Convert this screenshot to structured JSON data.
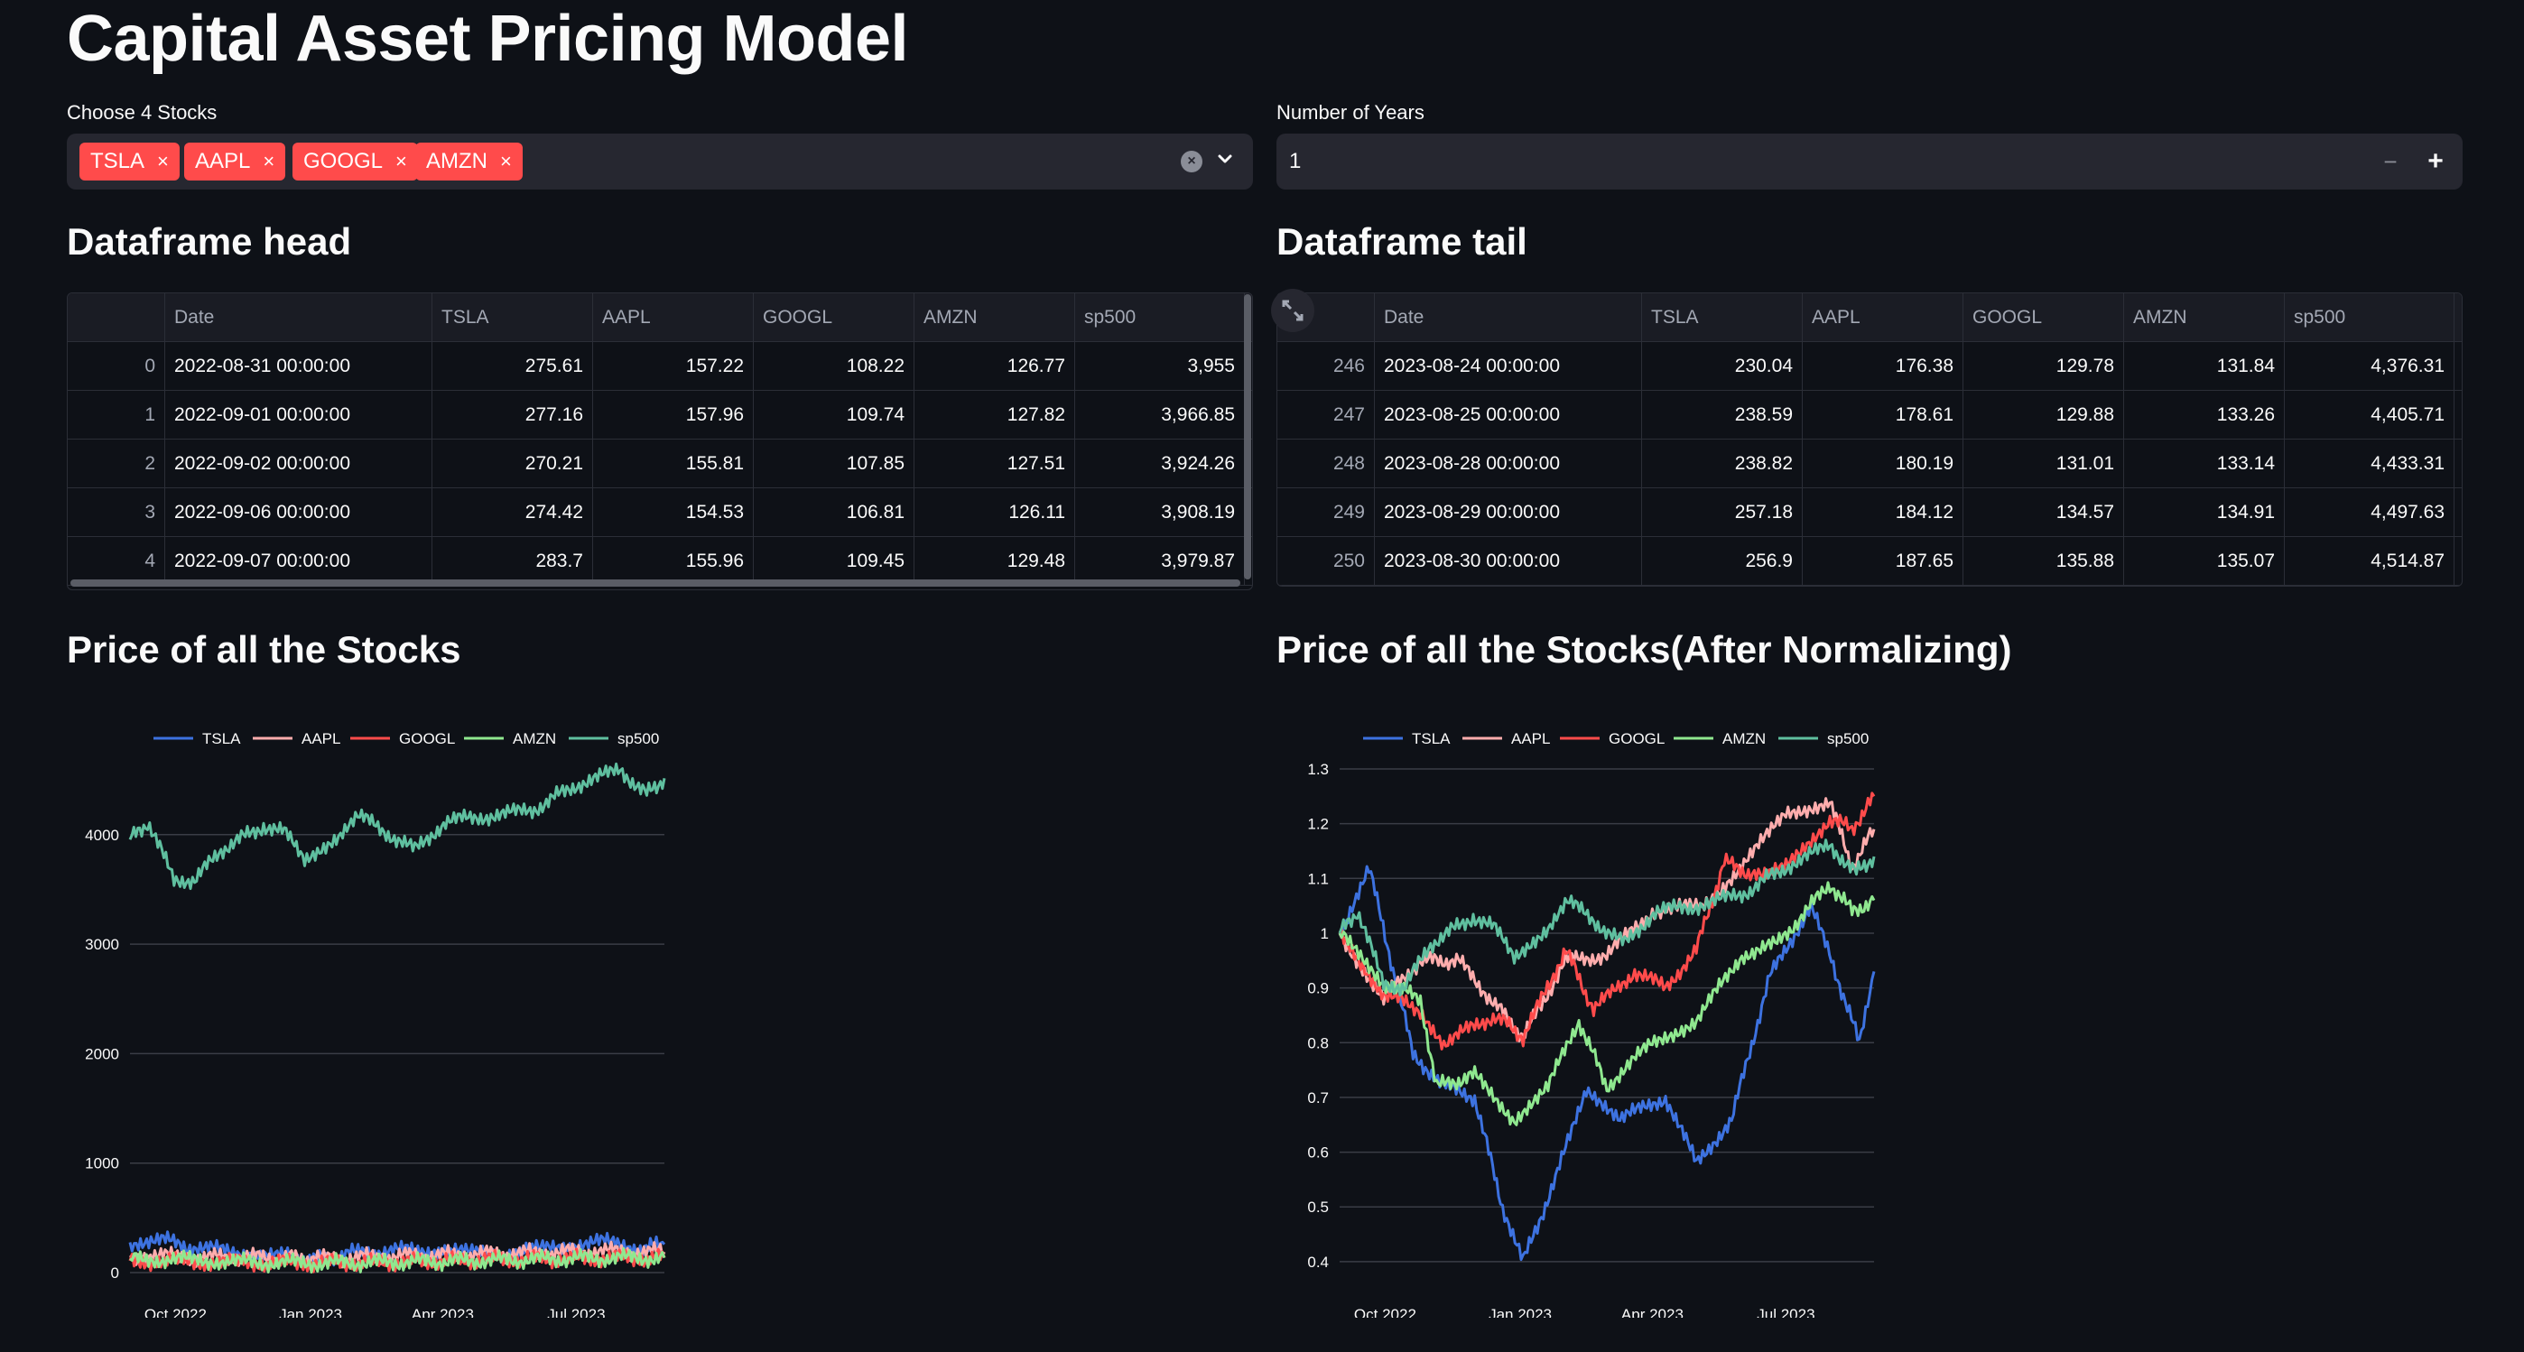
{
  "header": {
    "title": "Capital Asset Pricing Model"
  },
  "stock_select": {
    "label": "Choose 4 Stocks",
    "chips": [
      "TSLA",
      "AAPL",
      "GOOGL",
      "AMZN"
    ],
    "chip_remove": "×",
    "clear_glyph": "×",
    "icons": {
      "clear": "clear-icon",
      "dropdown": "chevron-down-icon"
    }
  },
  "years_input": {
    "label": "Number of Years",
    "value": "1",
    "minus": "−",
    "plus": "+"
  },
  "head_table": {
    "title": "Dataframe head",
    "columns": [
      "",
      "Date",
      "TSLA",
      "AAPL",
      "GOOGL",
      "AMZN",
      "sp500"
    ],
    "rows": [
      [
        "0",
        "2022-08-31 00:00:00",
        "275.61",
        "157.22",
        "108.22",
        "126.77",
        "3,955"
      ],
      [
        "1",
        "2022-09-01 00:00:00",
        "277.16",
        "157.96",
        "109.74",
        "127.82",
        "3,966.85"
      ],
      [
        "2",
        "2022-09-02 00:00:00",
        "270.21",
        "155.81",
        "107.85",
        "127.51",
        "3,924.26"
      ],
      [
        "3",
        "2022-09-06 00:00:00",
        "274.42",
        "154.53",
        "106.81",
        "126.11",
        "3,908.19"
      ],
      [
        "4",
        "2022-09-07 00:00:00",
        "283.7",
        "155.96",
        "109.45",
        "129.48",
        "3,979.87"
      ]
    ]
  },
  "tail_table": {
    "title": "Dataframe tail",
    "columns": [
      "",
      "Date",
      "TSLA",
      "AAPL",
      "GOOGL",
      "AMZN",
      "sp500"
    ],
    "rows": [
      [
        "246",
        "2023-08-24 00:00:00",
        "230.04",
        "176.38",
        "129.78",
        "131.84",
        "4,376.31"
      ],
      [
        "247",
        "2023-08-25 00:00:00",
        "238.59",
        "178.61",
        "129.88",
        "133.26",
        "4,405.71"
      ],
      [
        "248",
        "2023-08-28 00:00:00",
        "238.82",
        "180.19",
        "131.01",
        "133.14",
        "4,433.31"
      ],
      [
        "249",
        "2023-08-29 00:00:00",
        "257.18",
        "184.12",
        "134.57",
        "134.91",
        "4,497.63"
      ],
      [
        "250",
        "2023-08-30 00:00:00",
        "256.9",
        "187.65",
        "135.88",
        "135.07",
        "4,514.87"
      ]
    ]
  },
  "chart_titles": {
    "price": "Price of all the Stocks",
    "normalized": "Price of all the Stocks(After Normalizing)"
  },
  "colors": {
    "TSLA": "#3d72e0",
    "AAPL": "#ffadad",
    "GOOGL": "#ff4b4b",
    "AMZN": "#8fe88f",
    "sp500": "#5fbf9f",
    "grid": "#3a3d46",
    "text": "#fafafa"
  },
  "chart_data": [
    {
      "type": "line",
      "title": "",
      "x_ticks": [
        "Oct 2022",
        "Jan 2023",
        "Apr 2023",
        "Jul 2023"
      ],
      "x_range": [
        "2022-08-31",
        "2023-08-30"
      ],
      "ylim": [
        0,
        4600
      ],
      "y_ticks": [
        0,
        1000,
        2000,
        3000,
        4000
      ],
      "legend_position": "top",
      "grid": true,
      "series": [
        {
          "name": "TSLA",
          "points": [
            [
              "2022-08-31",
              276
            ],
            [
              "2022-09-20",
              305
            ],
            [
              "2022-10-15",
              225
            ],
            [
              "2022-11-15",
              185
            ],
            [
              "2022-12-15",
              150
            ],
            [
              "2023-01-03",
              110
            ],
            [
              "2023-02-01",
              185
            ],
            [
              "2023-03-01",
              200
            ],
            [
              "2023-04-01",
              205
            ],
            [
              "2023-05-01",
              160
            ],
            [
              "2023-06-01",
              205
            ],
            [
              "2023-07-15",
              285
            ],
            [
              "2023-08-15",
              225
            ],
            [
              "2023-08-30",
              257
            ]
          ]
        },
        {
          "name": "AAPL",
          "points": [
            [
              "2022-08-31",
              157
            ],
            [
              "2022-10-15",
              140
            ],
            [
              "2022-12-15",
              140
            ],
            [
              "2023-01-03",
              125
            ],
            [
              "2023-03-01",
              150
            ],
            [
              "2023-05-01",
              170
            ],
            [
              "2023-07-15",
              195
            ],
            [
              "2023-08-30",
              188
            ]
          ]
        },
        {
          "name": "GOOGL",
          "points": [
            [
              "2022-08-31",
              108
            ],
            [
              "2022-10-15",
              100
            ],
            [
              "2022-11-15",
              90
            ],
            [
              "2023-01-03",
              88
            ],
            [
              "2023-03-01",
              95
            ],
            [
              "2023-05-01",
              120
            ],
            [
              "2023-07-15",
              130
            ],
            [
              "2023-08-30",
              136
            ]
          ]
        },
        {
          "name": "AMZN",
          "points": [
            [
              "2022-08-31",
              127
            ],
            [
              "2022-10-15",
              115
            ],
            [
              "2022-11-15",
              95
            ],
            [
              "2023-01-03",
              85
            ],
            [
              "2023-03-01",
              95
            ],
            [
              "2023-05-01",
              110
            ],
            [
              "2023-07-15",
              133
            ],
            [
              "2023-08-30",
              135
            ]
          ]
        },
        {
          "name": "sp500",
          "points": [
            [
              "2022-08-31",
              3955
            ],
            [
              "2022-09-12",
              4110
            ],
            [
              "2022-09-30",
              3600
            ],
            [
              "2022-10-14",
              3580
            ],
            [
              "2022-11-01",
              3860
            ],
            [
              "2022-11-30",
              4080
            ],
            [
              "2022-12-14",
              4020
            ],
            [
              "2022-12-28",
              3790
            ],
            [
              "2023-01-20",
              3990
            ],
            [
              "2023-02-02",
              4180
            ],
            [
              "2023-03-13",
              3860
            ],
            [
              "2023-04-03",
              4120
            ],
            [
              "2023-05-01",
              4170
            ],
            [
              "2023-06-01",
              4220
            ],
            [
              "2023-06-30",
              4450
            ],
            [
              "2023-07-31",
              4590
            ],
            [
              "2023-08-18",
              4370
            ],
            [
              "2023-08-30",
              4515
            ]
          ]
        }
      ]
    },
    {
      "type": "line",
      "title": "",
      "x_ticks": [
        "Oct 2022",
        "Jan 2023",
        "Apr 2023",
        "Jul 2023"
      ],
      "x_range": [
        "2022-08-31",
        "2023-08-30"
      ],
      "ylim": [
        0.38,
        1.3
      ],
      "y_ticks": [
        0.4,
        0.5,
        0.6,
        0.7,
        0.8,
        0.9,
        1,
        1.1,
        1.2,
        1.3
      ],
      "legend_position": "top",
      "grid": true,
      "series": [
        {
          "name": "TSLA",
          "points": [
            [
              "2022-08-31",
              1.0
            ],
            [
              "2022-09-20",
              1.12
            ],
            [
              "2022-10-05",
              0.95
            ],
            [
              "2022-10-20",
              0.78
            ],
            [
              "2022-11-10",
              0.72
            ],
            [
              "2022-12-01",
              0.7
            ],
            [
              "2022-12-20",
              0.5
            ],
            [
              "2023-01-03",
              0.4
            ],
            [
              "2023-01-25",
              0.55
            ],
            [
              "2023-02-15",
              0.72
            ],
            [
              "2023-03-10",
              0.66
            ],
            [
              "2023-04-10",
              0.7
            ],
            [
              "2023-05-01",
              0.58
            ],
            [
              "2023-05-25",
              0.66
            ],
            [
              "2023-06-20",
              0.92
            ],
            [
              "2023-07-18",
              1.05
            ],
            [
              "2023-08-01",
              0.95
            ],
            [
              "2023-08-20",
              0.8
            ],
            [
              "2023-08-30",
              0.93
            ]
          ]
        },
        {
          "name": "AAPL",
          "points": [
            [
              "2022-08-31",
              1.0
            ],
            [
              "2022-09-30",
              0.88
            ],
            [
              "2022-10-25",
              0.95
            ],
            [
              "2022-11-20",
              0.95
            ],
            [
              "2022-12-15",
              0.87
            ],
            [
              "2023-01-03",
              0.81
            ],
            [
              "2023-02-01",
              0.95
            ],
            [
              "2023-03-01",
              0.96
            ],
            [
              "2023-04-01",
              1.04
            ],
            [
              "2023-05-05",
              1.05
            ],
            [
              "2023-06-01",
              1.12
            ],
            [
              "2023-07-01",
              1.22
            ],
            [
              "2023-07-31",
              1.24
            ],
            [
              "2023-08-15",
              1.12
            ],
            [
              "2023-08-30",
              1.19
            ]
          ]
        },
        {
          "name": "GOOGL",
          "points": [
            [
              "2022-08-31",
              1.0
            ],
            [
              "2022-09-30",
              0.89
            ],
            [
              "2022-10-25",
              0.86
            ],
            [
              "2022-11-10",
              0.8
            ],
            [
              "2022-12-15",
              0.85
            ],
            [
              "2023-01-03",
              0.81
            ],
            [
              "2023-02-01",
              0.97
            ],
            [
              "2023-02-20",
              0.86
            ],
            [
              "2023-03-20",
              0.93
            ],
            [
              "2023-04-10",
              0.9
            ],
            [
              "2023-05-01",
              0.97
            ],
            [
              "2023-05-20",
              1.13
            ],
            [
              "2023-06-15",
              1.1
            ],
            [
              "2023-07-01",
              1.12
            ],
            [
              "2023-07-31",
              1.21
            ],
            [
              "2023-08-15",
              1.19
            ],
            [
              "2023-08-30",
              1.25
            ]
          ]
        },
        {
          "name": "AMZN",
          "points": [
            [
              "2022-08-31",
              1.0
            ],
            [
              "2022-09-30",
              0.91
            ],
            [
              "2022-10-25",
              0.88
            ],
            [
              "2022-11-05",
              0.72
            ],
            [
              "2022-12-01",
              0.74
            ],
            [
              "2022-12-28",
              0.66
            ],
            [
              "2023-01-20",
              0.72
            ],
            [
              "2023-02-10",
              0.84
            ],
            [
              "2023-03-01",
              0.72
            ],
            [
              "2023-04-01",
              0.8
            ],
            [
              "2023-05-01",
              0.84
            ],
            [
              "2023-06-01",
              0.96
            ],
            [
              "2023-06-25",
              0.98
            ],
            [
              "2023-07-31",
              1.09
            ],
            [
              "2023-08-15",
              1.04
            ],
            [
              "2023-08-30",
              1.06
            ]
          ]
        },
        {
          "name": "sp500",
          "points": [
            [
              "2022-08-31",
              1.0
            ],
            [
              "2022-09-12",
              1.04
            ],
            [
              "2022-09-30",
              0.91
            ],
            [
              "2022-10-14",
              0.9
            ],
            [
              "2022-11-01",
              0.98
            ],
            [
              "2022-11-30",
              1.03
            ],
            [
              "2022-12-14",
              1.01
            ],
            [
              "2022-12-28",
              0.96
            ],
            [
              "2023-01-20",
              1.01
            ],
            [
              "2023-02-02",
              1.06
            ],
            [
              "2023-03-13",
              0.98
            ],
            [
              "2023-04-03",
              1.04
            ],
            [
              "2023-05-01",
              1.05
            ],
            [
              "2023-06-01",
              1.07
            ],
            [
              "2023-06-30",
              1.12
            ],
            [
              "2023-07-31",
              1.16
            ],
            [
              "2023-08-18",
              1.11
            ],
            [
              "2023-08-30",
              1.14
            ]
          ]
        }
      ]
    }
  ]
}
